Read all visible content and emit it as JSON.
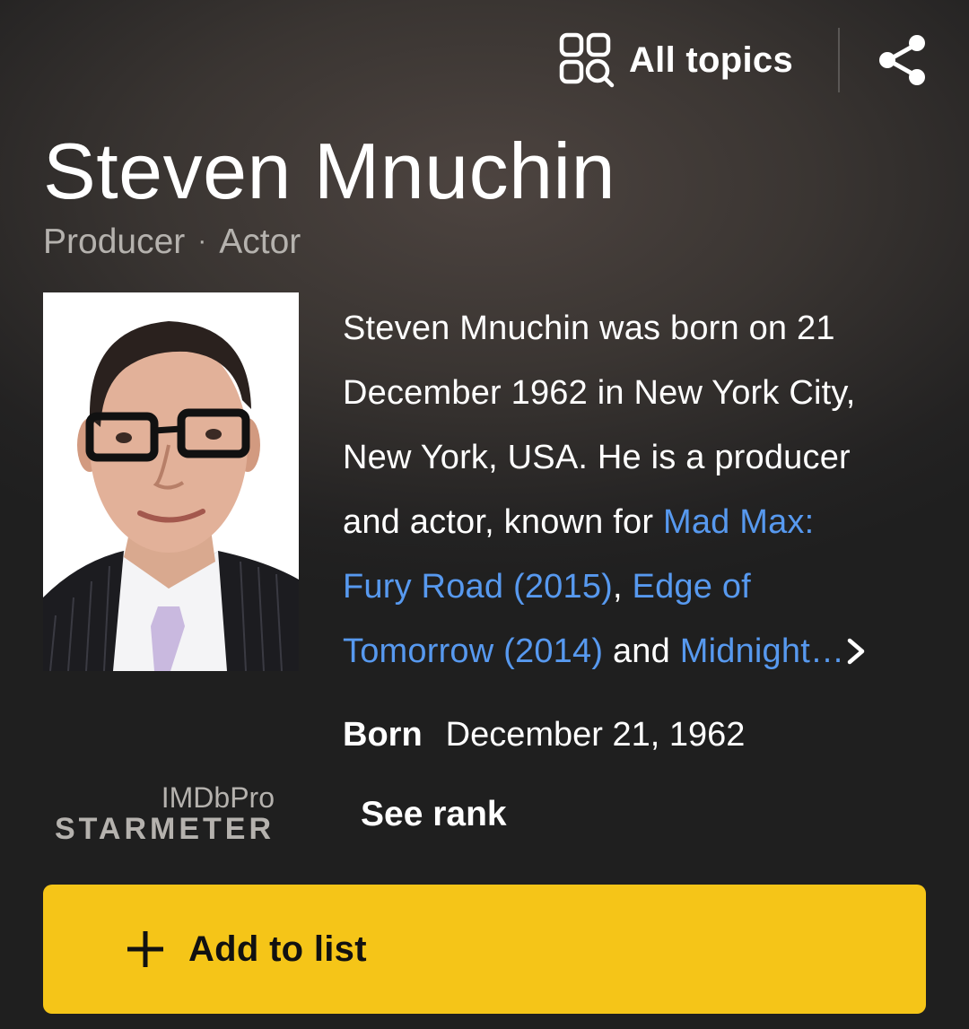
{
  "header": {
    "all_topics_label": "All topics",
    "topics_icon": "topics-search-icon",
    "share_icon": "share-icon"
  },
  "person": {
    "name": "Steven Mnuchin",
    "role_1": "Producer",
    "role_separator": "·",
    "role_2": "Actor",
    "photo_icon": "portrait-photo"
  },
  "bio": {
    "line1": "Steven Mnuchin was born on 21",
    "line2": "December 1962 in New York City,",
    "line3": "New York, USA. He is a producer",
    "line4_text": "and actor, known for ",
    "link1_part1": "Mad Max:",
    "link1_part2": "Fury Road (2015)",
    "comma": ", ",
    "link2_part1": "Edge of",
    "link2_part2": "Tomorrow (2014)",
    "and_text": " and ",
    "link3": "Midnight…",
    "more_icon": "chevron-right-icon"
  },
  "details": {
    "born_label": "Born",
    "born_value": "December 21, 1962"
  },
  "starmeter": {
    "brand_top": "IMDbPro",
    "brand_bottom": "STARMETER",
    "see_rank_label": "See rank"
  },
  "actions": {
    "add_to_list_label": "Add to list",
    "add_icon": "plus-icon"
  },
  "colors": {
    "accent": "#f5c518",
    "link": "#5799ef",
    "muted_text": "#b5b2ae"
  }
}
